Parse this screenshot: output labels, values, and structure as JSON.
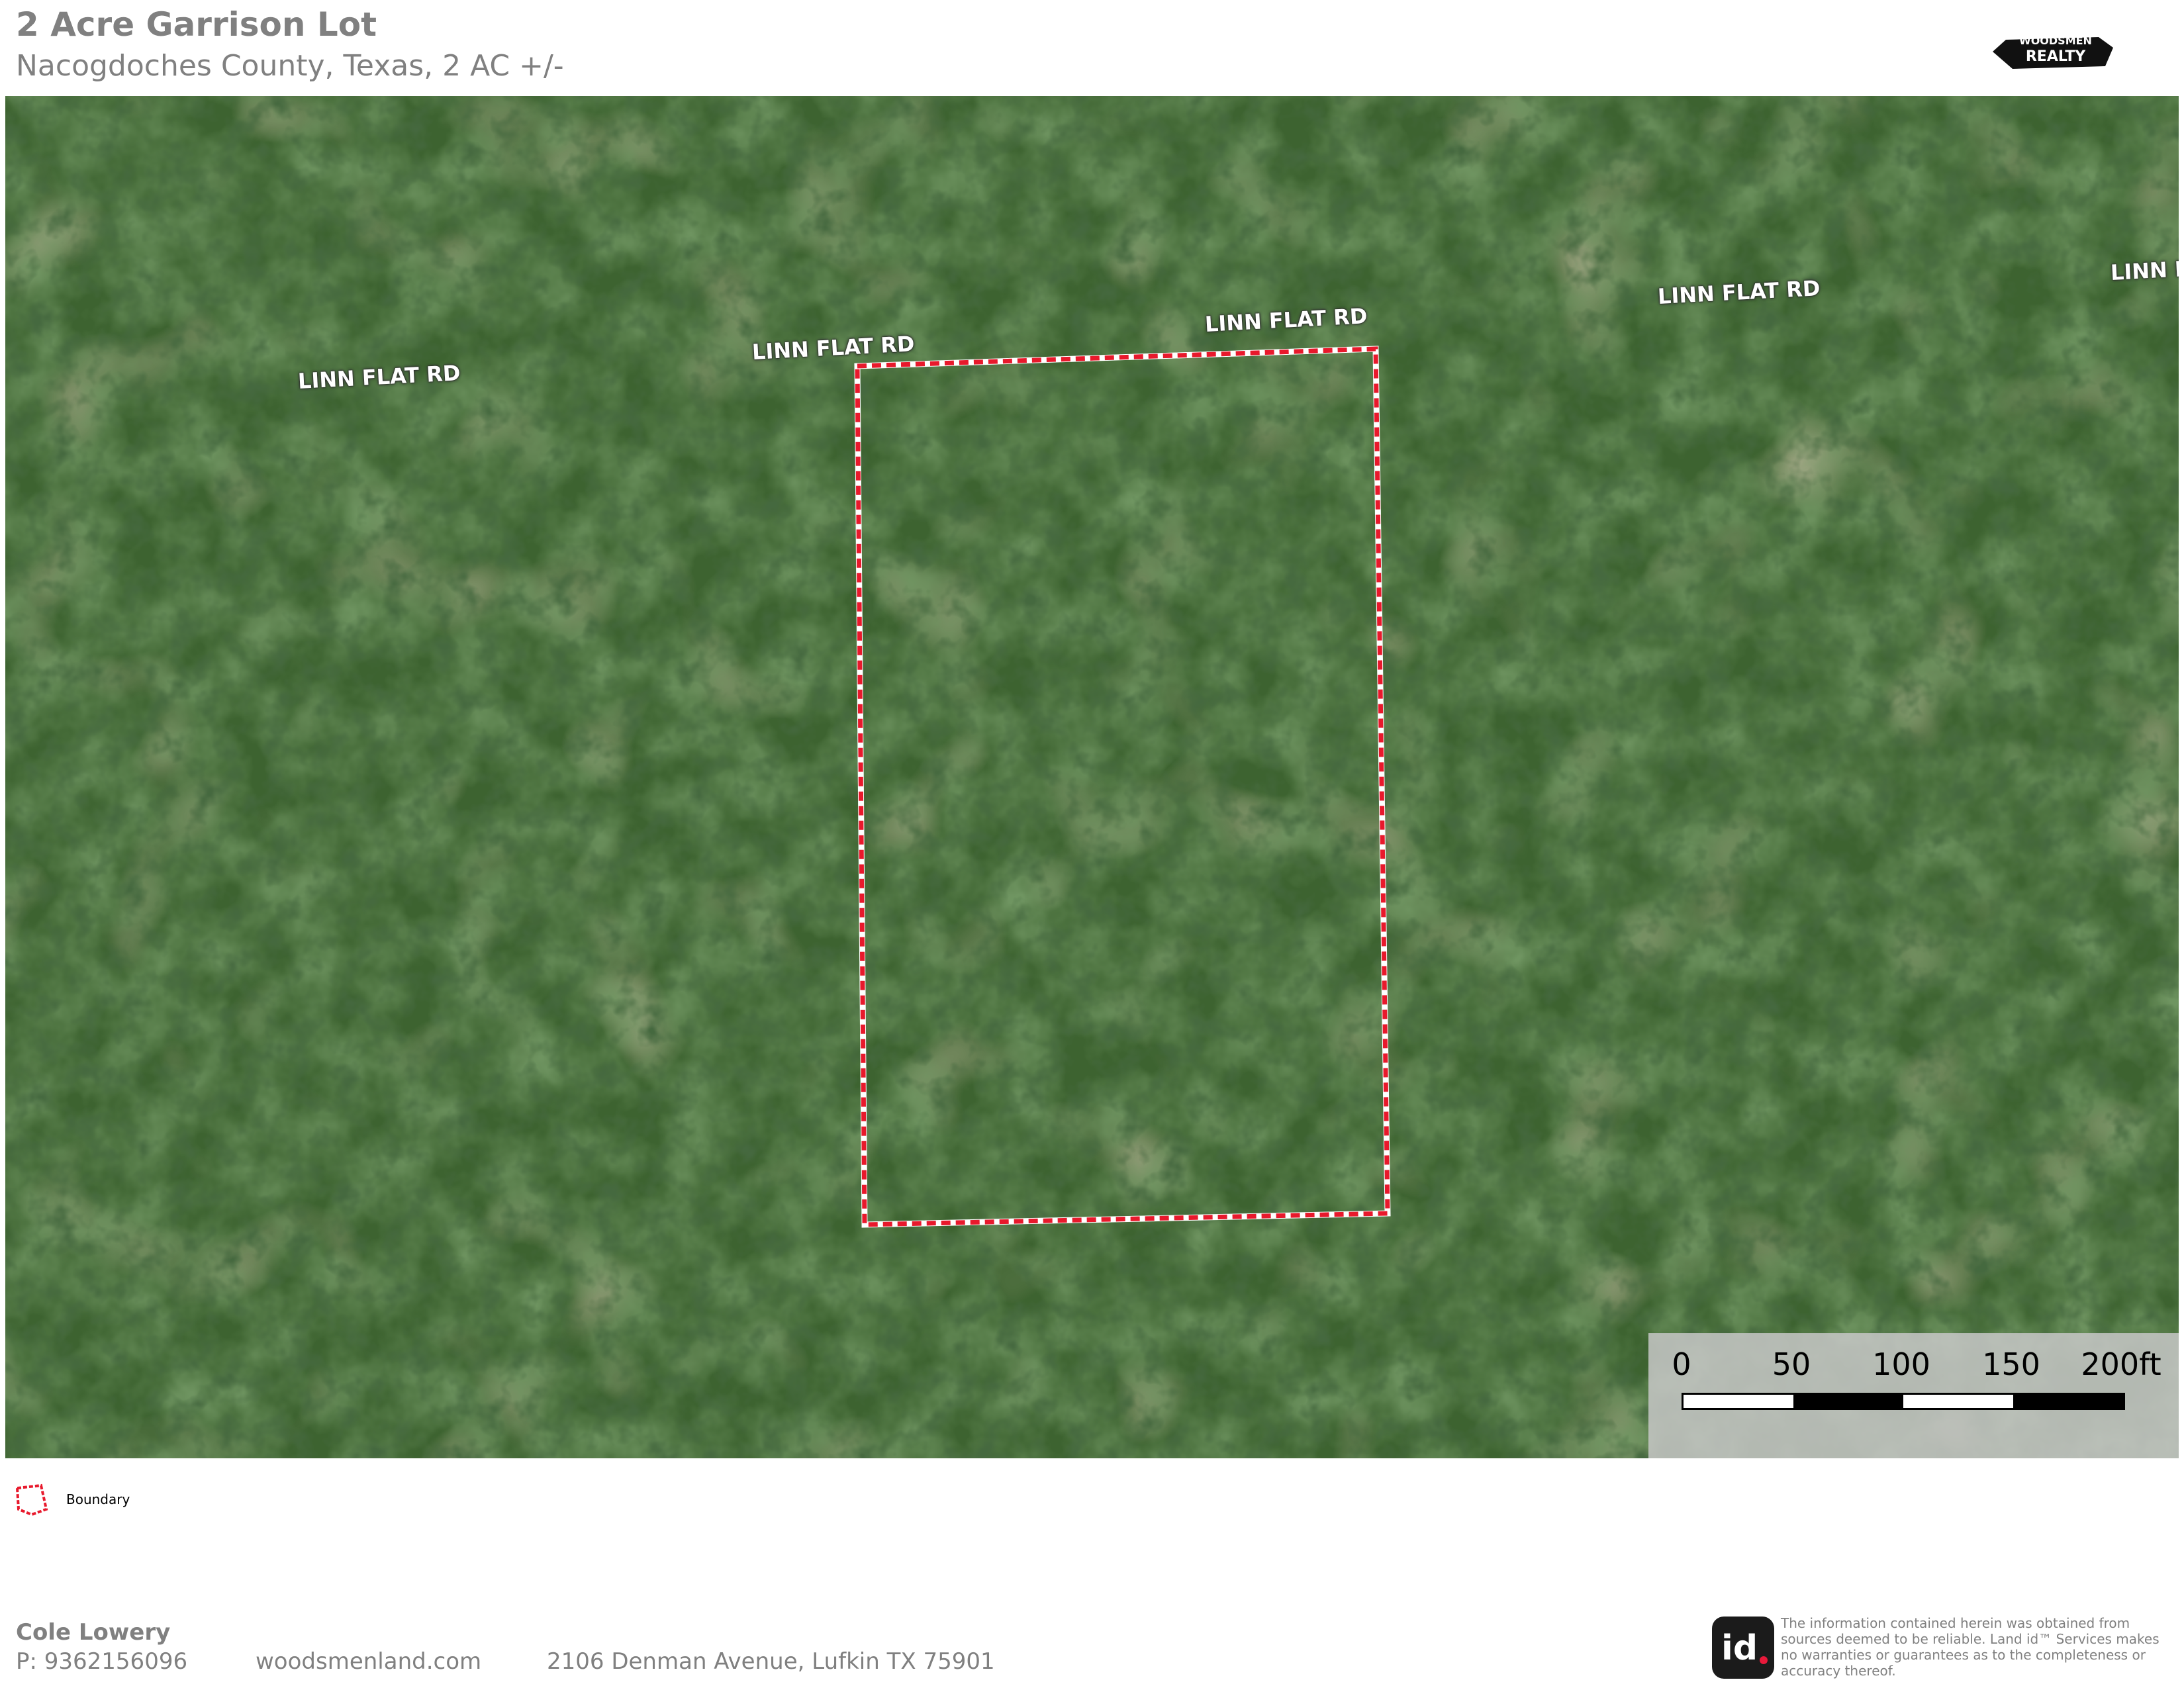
{
  "header": {
    "title": "2 Acre Garrison Lot",
    "subtitle": "Nacogdoches County, Texas, 2 AC +/-",
    "logo_text_line1": "WOODSMEN",
    "logo_text_line2": "REALTY"
  },
  "map": {
    "road_labels": [
      "LINN FLAT RD",
      "LINN FLAT RD",
      "LINN FLAT RD",
      "LINN FLAT RD",
      "LINN F"
    ],
    "boundary_color": "#e8192c",
    "scale": {
      "ticks": [
        "0",
        "50",
        "100",
        "150",
        "200ft"
      ]
    }
  },
  "legend": {
    "items": [
      {
        "label": "Boundary",
        "icon": "boundary-polygon-icon"
      }
    ]
  },
  "footer": {
    "agent_name": "Cole Lowery",
    "phone": "P: 9362156096",
    "website": "woodsmenland.com",
    "address": "2106 Denman Avenue, Lufkin TX 75901",
    "id_logo": "id.",
    "disclaimer": "The information contained herein was obtained from sources deemed to be reliable.  Land id™ Services makes no warranties or guarantees as to the completeness or accuracy thereof."
  }
}
